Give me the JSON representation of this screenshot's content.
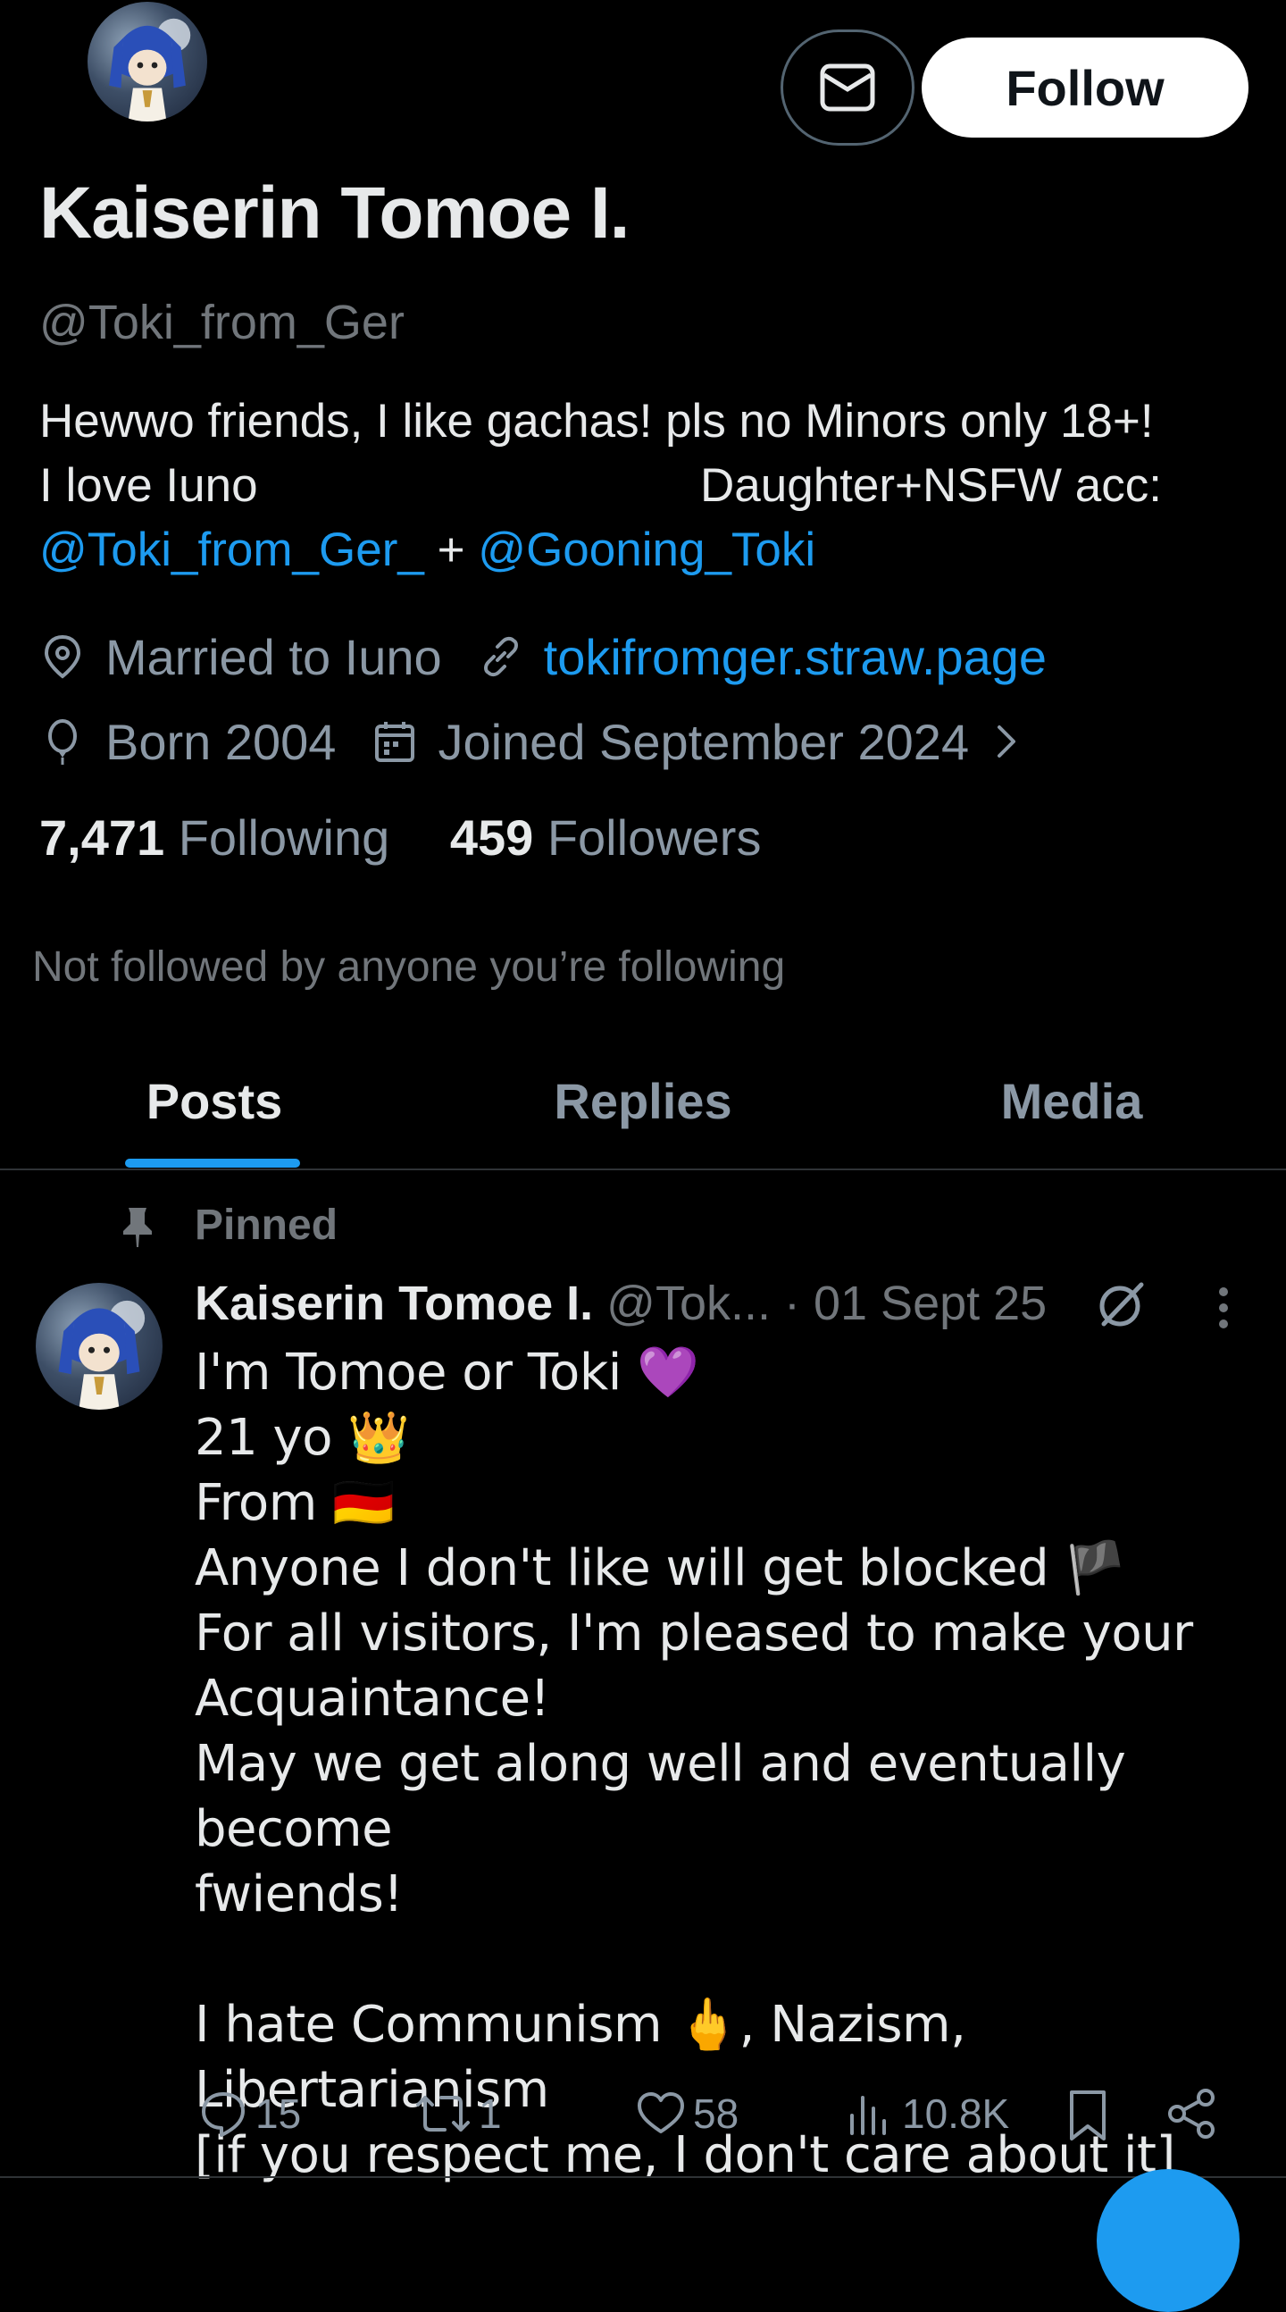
{
  "header": {
    "follow_label": "Follow"
  },
  "profile": {
    "display_name": "Kaiserin Tomoe I.",
    "handle": "@Toki_from_Ger",
    "bio": {
      "line1": "Hewwo friends, I like gachas! pls no Minors only 18+!",
      "line2_left": "I love Iuno",
      "line2_right": "Daughter+NSFW acc:",
      "mention1": "@Toki_from_Ger_",
      "joiner": "+",
      "mention2": "@Gooning_Toki"
    },
    "location": "Married to Iuno",
    "website": "tokifromger.straw.page",
    "birth": "Born 2004",
    "joined": "Joined September 2024",
    "following_count": "7,471",
    "following_label": "Following",
    "followers_count": "459",
    "followers_label": "Followers",
    "not_followed": "Not followed by anyone you’re following"
  },
  "tabs": [
    {
      "label": "Posts",
      "active": true
    },
    {
      "label": "Replies",
      "active": false
    },
    {
      "label": "Media",
      "active": false
    }
  ],
  "pinned_post": {
    "pinned_label": "Pinned",
    "author_name": "Kaiserin Tomoe I.",
    "author_handle": "@Tok...",
    "date": "· 01 Sept 25",
    "text": "I'm Tomoe or Toki 💜\n21 yo 👑\nFrom 🇩🇪\nAnyone I don't like will get blocked 🏴\nFor all visitors, I'm pleased to make your\nAcquaintance!\nMay we get along well and eventually become\nfwiends!\n\nI hate Communism 🖕, Nazism, Libertarianism\n[if you respect me, I don't care about it]",
    "replies": "15",
    "reposts": "1",
    "likes": "58",
    "views": "10.8K"
  },
  "colors": {
    "background": "#000000",
    "text_primary": "#e7e9ea",
    "text_secondary": "#71767b",
    "accent": "#1d9bf0",
    "divider": "#2f3336"
  },
  "icons": [
    "mail-icon",
    "location-pin-icon",
    "link-icon",
    "birthday-balloon-icon",
    "calendar-icon",
    "chevron-right-icon",
    "pin-icon",
    "grok-icon",
    "more-icon",
    "reply-icon",
    "repost-icon",
    "like-icon",
    "views-icon",
    "bookmark-icon",
    "share-icon"
  ]
}
